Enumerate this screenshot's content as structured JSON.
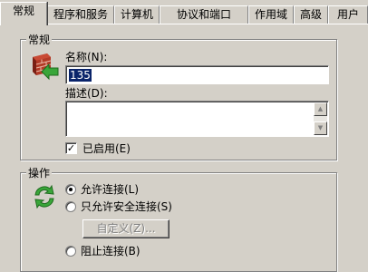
{
  "tabs": [
    {
      "label": "常规",
      "active": true
    },
    {
      "label": "程序和服务",
      "active": false
    },
    {
      "label": "计算机",
      "active": false
    },
    {
      "label": "协议和端口",
      "active": false
    },
    {
      "label": "作用域",
      "active": false
    },
    {
      "label": "高级",
      "active": false
    },
    {
      "label": "用户",
      "active": false
    }
  ],
  "general_group": {
    "title": "常规",
    "icon": "firewall-rule-icon",
    "name_label": "名称(N):",
    "name_value": "135",
    "description_label": "描述(D):",
    "description_value": "",
    "enabled_label": "已启用(E)",
    "enabled_checked": true
  },
  "action_group": {
    "title": "操作",
    "icon": "refresh-arrows-icon",
    "options": [
      {
        "label": "允许连接(L)",
        "selected": true
      },
      {
        "label": "只允许安全连接(S)",
        "selected": false
      },
      {
        "label": "阻止连接(B)",
        "selected": false
      }
    ],
    "customize_button": "自定义(Z)...",
    "customize_enabled": false
  },
  "colors": {
    "window_bg": "#d4d0c8",
    "selection_bg": "#0a246a",
    "icon_green": "#3aa63a"
  }
}
